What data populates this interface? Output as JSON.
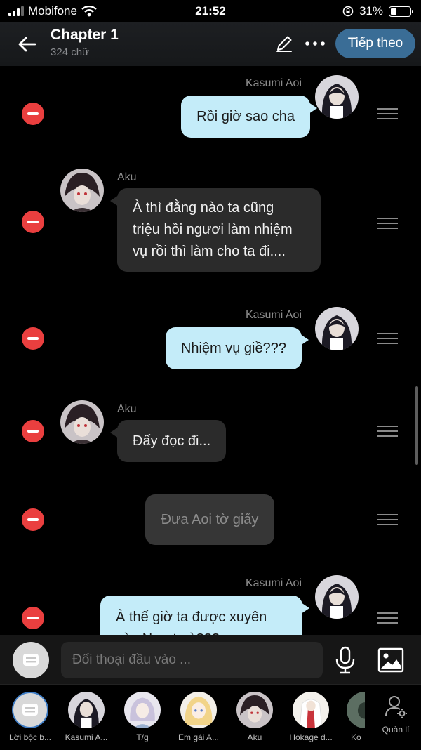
{
  "status_bar": {
    "carrier": "Mobifone",
    "time": "21:52",
    "battery": "31%",
    "battery_level": 0.31
  },
  "header": {
    "title": "Chapter 1",
    "word_count": "324 chữ",
    "next_label": "Tiếp theo"
  },
  "messages": [
    {
      "speaker": "Kasumi Aoi",
      "side": "right",
      "lines": [
        "Rồi giờ sao cha"
      ]
    },
    {
      "speaker": "Aku",
      "side": "left",
      "lines": [
        "À thì đằng nào ta cũng",
        "triệu hồi ngươi làm nhiệm",
        "vụ rồi thì làm cho ta đi...."
      ]
    },
    {
      "speaker": "Kasumi Aoi",
      "side": "right",
      "lines": [
        "Nhiệm vụ giề???"
      ]
    },
    {
      "speaker": "Aku",
      "side": "left",
      "lines": [
        "Đấy đọc đi..."
      ]
    },
    {
      "speaker": "",
      "side": "narration",
      "lines": [
        "Đưa Aoi tờ giấy"
      ]
    },
    {
      "speaker": "Kasumi Aoi",
      "side": "right",
      "lines": [
        "À thế giờ ta được xuyên",
        "vào Naruto à???"
      ]
    }
  ],
  "input": {
    "placeholder": "Đối thoại đầu vào ..."
  },
  "characters": [
    {
      "label": "Lời bộc b..."
    },
    {
      "label": "Kasumi A..."
    },
    {
      "label": "T/g"
    },
    {
      "label": "Em gái A..."
    },
    {
      "label": "Aku"
    },
    {
      "label": "Hokage đ..."
    },
    {
      "label": "Ko"
    }
  ],
  "manage_label": "Quản lí",
  "colors": {
    "accent": "#3a6d96",
    "bubble_user": "#c4ecf9",
    "bubble_other": "#2b2b2b",
    "delete": "#ea3f3f"
  }
}
